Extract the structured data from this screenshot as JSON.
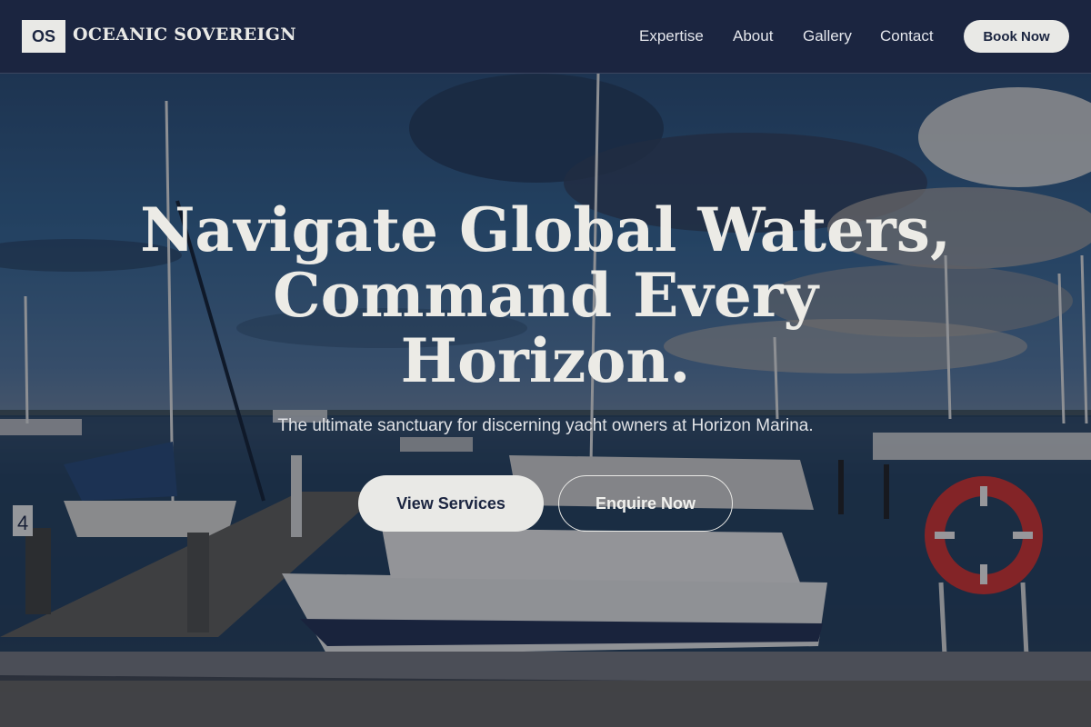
{
  "header": {
    "logo_initials": "OS",
    "brand_name": "OCEANIC SOVEREIGN",
    "nav": [
      {
        "label": "Expertise"
      },
      {
        "label": "About"
      },
      {
        "label": "Gallery"
      },
      {
        "label": "Contact"
      }
    ],
    "book_label": "Book Now"
  },
  "hero": {
    "headline_lines": [
      "Navigate Global Waters,",
      "Command Every",
      "Horizon."
    ],
    "subtitle": "The ultimate sanctuary for discerning yacht owners at Horizon Marina.",
    "primary_cta": "View Services",
    "secondary_cta": "Enquire Now",
    "pier_marker": "4"
  },
  "colors": {
    "navy": "#1b2540",
    "cream": "#e9e9e6",
    "lifebuoy": "#d4302b"
  }
}
